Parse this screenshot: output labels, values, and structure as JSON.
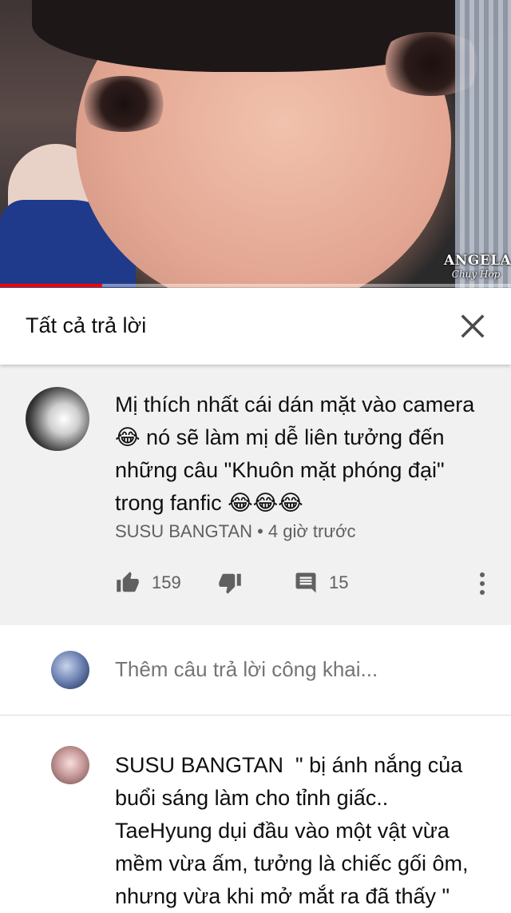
{
  "video": {
    "watermark_line1": "ANGELA",
    "watermark_line2": "Chụy Hợp",
    "progress": 0.2
  },
  "header": {
    "title": "Tất cả trả lời",
    "close_icon": "close-icon"
  },
  "comment": {
    "text": "Mị thích nhất cái dán mặt vào camera 😂 nó sẽ làm mị dễ liên tưởng đến những câu \"Khuôn mặt phóng đại\" trong fanfic 😂😂😂",
    "author": "SUSU BANGTAN",
    "time": "4 giờ trước",
    "likes": "159",
    "replies": "15"
  },
  "add_reply": {
    "placeholder": "Thêm câu trả lời công khai..."
  },
  "reply": {
    "author": "SUSU BANGTAN",
    "text": "\" bị ánh nắng của buổi sáng làm cho tỉnh giấc.. TaeHyung dụi đầu vào một vật vừa mềm vừa ấm, tưởng là chiếc gối ôm, nhưng vừa khi mở mắt ra đã thấy \""
  },
  "colors": {
    "progress": "#ff0000",
    "comment_bg": "#f1f1f1",
    "meta_text": "#606060"
  }
}
